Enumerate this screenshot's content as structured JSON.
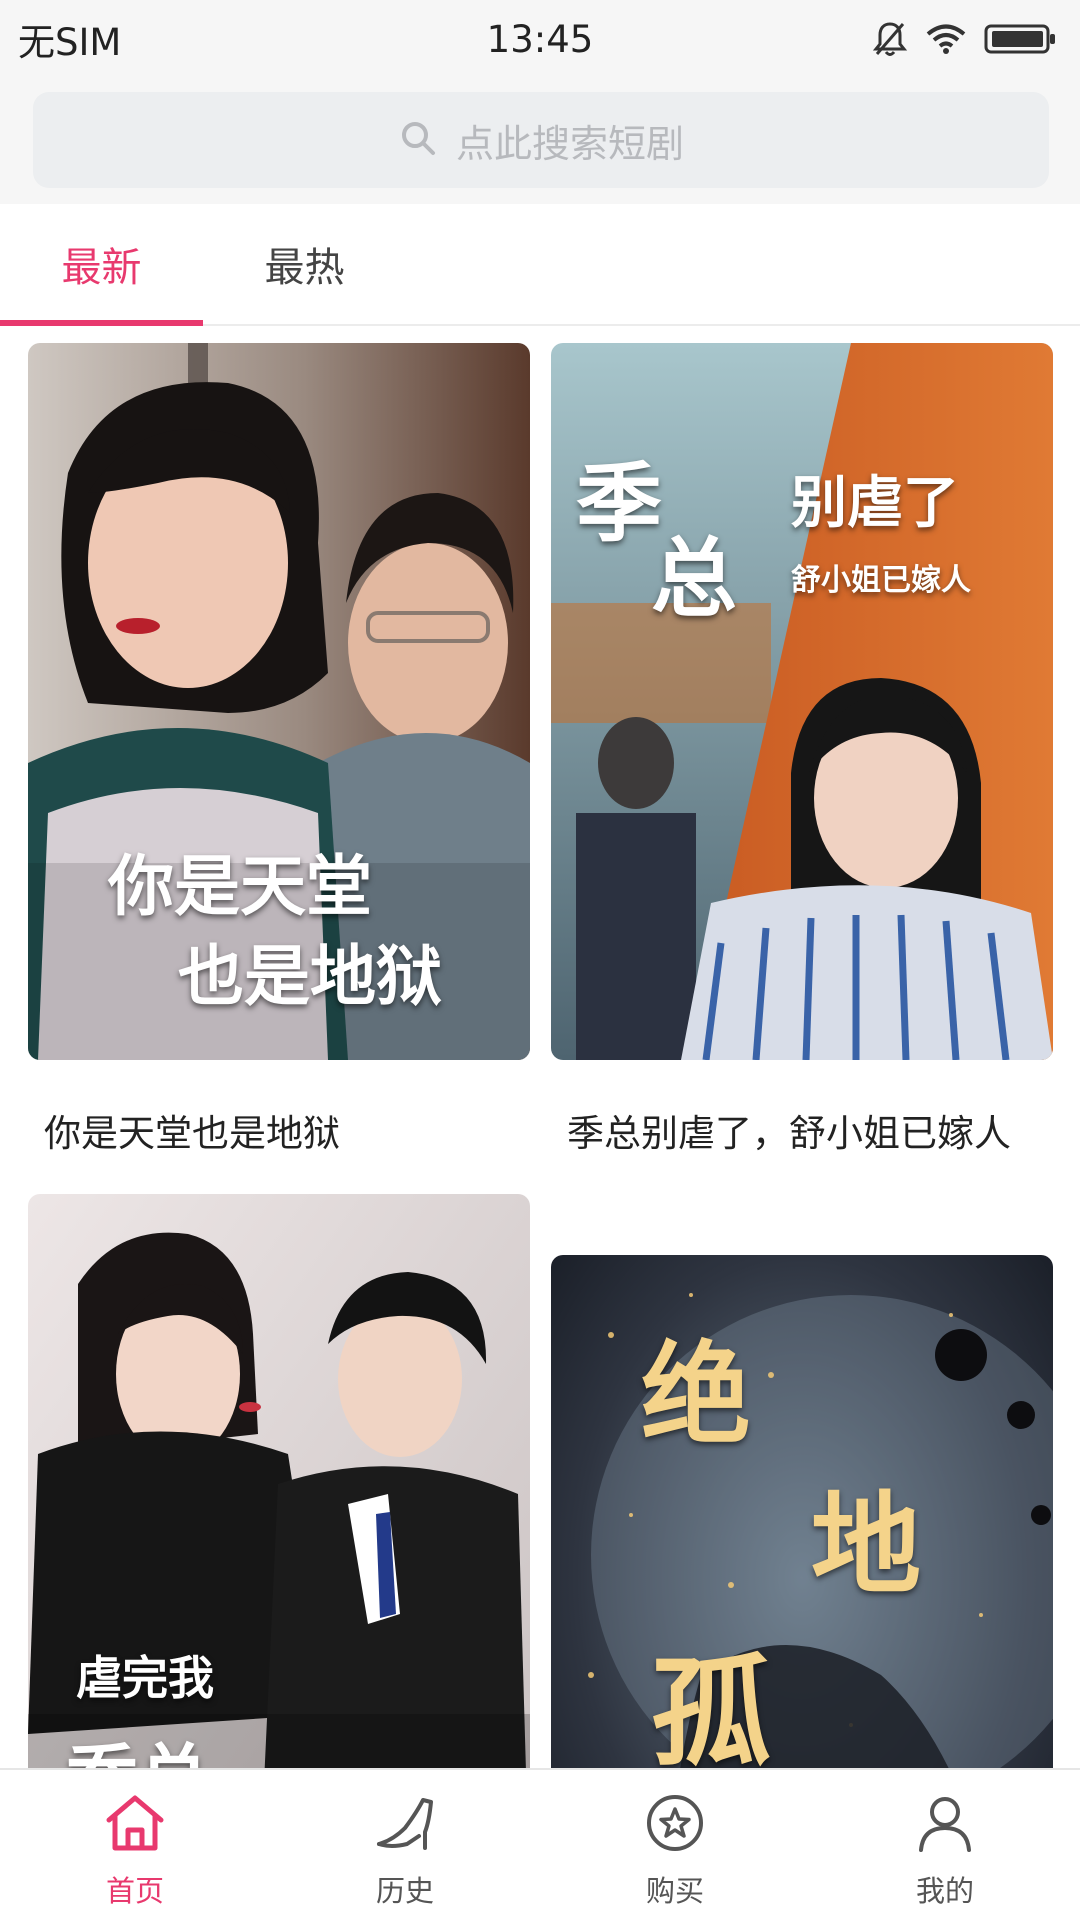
{
  "status_bar": {
    "carrier": "无SIM",
    "time": "13:45",
    "icons": [
      "bell-off-icon",
      "wifi-icon",
      "battery-icon"
    ]
  },
  "search": {
    "placeholder": "点此搜索短剧",
    "icon": "search-icon"
  },
  "tabs": [
    {
      "label": "最新",
      "active": true
    },
    {
      "label": "最热",
      "active": false
    }
  ],
  "dramas": [
    {
      "title": "你是天堂也是地狱",
      "poster_text": [
        "你是天堂",
        "也是地狱"
      ]
    },
    {
      "title": "季总别虐了，舒小姐已嫁人",
      "poster_text": [
        "季",
        "总",
        "别虐了",
        "舒小姐已嫁人"
      ]
    },
    {
      "title": "",
      "poster_text": [
        "虐完我",
        "乔总"
      ]
    },
    {
      "title": "",
      "poster_text": [
        "绝",
        "地",
        "孤"
      ]
    }
  ],
  "bottom_nav": [
    {
      "label": "首页",
      "icon": "home-icon",
      "active": true
    },
    {
      "label": "历史",
      "icon": "high-heel-icon",
      "active": false
    },
    {
      "label": "购买",
      "icon": "star-circle-icon",
      "active": false
    },
    {
      "label": "我的",
      "icon": "user-icon",
      "active": false
    }
  ],
  "colors": {
    "accent": "#e8396e",
    "background": "#ffffff",
    "status_bg": "#f6f6f6"
  }
}
